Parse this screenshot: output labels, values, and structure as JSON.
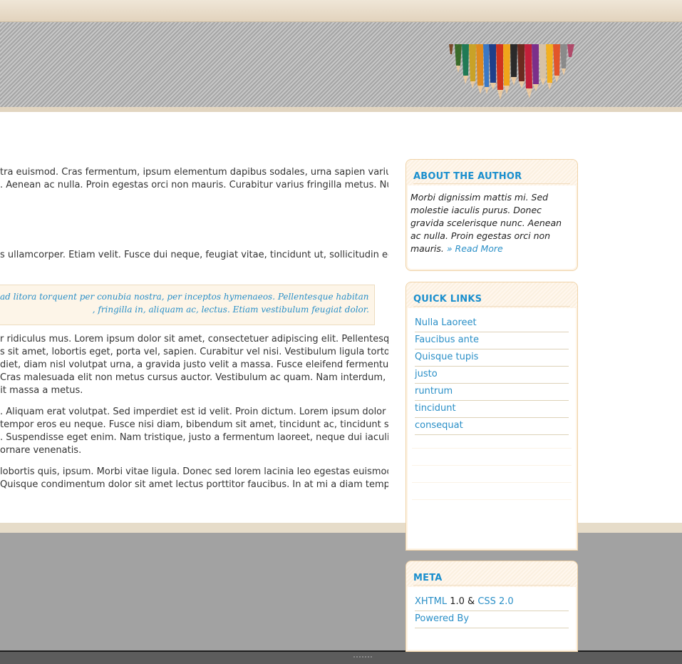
{
  "main": {
    "paragraphs": [
      {
        "lines": [
          "tra euismod. Cras fermentum, ipsum elementum dapibus sodales, urna sapien varius",
          ". Aenean ac nulla. Proin egestas orci non mauris. Curabitur varius fringilla metus. Nulla"
        ]
      },
      {
        "lines": [
          "s ullamcorper. Etiam velit. Fusce dui neque, feugiat vitae, tincidunt ut, sollicitudin eget,"
        ]
      },
      {
        "lines": [
          "r ridiculus mus. Lorem ipsum dolor sit amet, consectetuer adipiscing elit. Pellentesque",
          "s sit amet, lobortis eget, porta vel, sapien. Curabitur vel nisi. Vestibulum ligula tortor,",
          "diet, diam nisl volutpat urna, a gravida justo velit a massa. Fusce eleifend fermentum",
          "Cras malesuada elit non metus cursus auctor. Vestibulum ac quam. Nam interdum, orci",
          "bit massa a metus."
        ]
      },
      {
        "lines": [
          ". Aliquam erat volutpat. Sed imperdiet est id velit. Proin dictum. Lorem ipsum dolor sit",
          "tempor eros eu neque. Fusce nisi diam, bibendum sit amet, tincidunt ac, tincidunt sit",
          ". Suspendisse eget enim. Nam tristique, justo a fermentum laoreet, neque dui iaculis",
          "ornare venenatis."
        ]
      },
      {
        "lines": [
          "lobortis quis, ipsum. Morbi vitae ligula. Donec sed lorem lacinia leo egestas euismod.",
          "Quisque condimentum dolor sit amet lectus porttitor faucibus. In at mi a diam tempus"
        ]
      }
    ],
    "quote_lines": [
      "ad litora torquent per conubia nostra, per inceptos hymenaeos. Pellentesque habitant morbi",
      ", fringilla in, aliquam ac, lectus. Etiam vestibulum feugiat dolor."
    ]
  },
  "sidebar": {
    "about": {
      "title": "ABOUT THE AUTHOR",
      "text": "Morbi dignissim mattis mi. Sed molestie iaculis purus. Donec gravida scelerisque nunc. Aenean ac nulla. Proin egestas orci non mauris.",
      "read_more": "» Read More"
    },
    "quick_links": {
      "title": "QUICK LINKS",
      "items": [
        "Nulla Laoreet",
        "Faucibus ante",
        "Quisque tupis",
        "justo",
        "runtrum",
        "tincidunt",
        "consequat"
      ]
    },
    "meta": {
      "title": "META",
      "xhtml": "XHTML",
      "version_sep": " 1.0 & ",
      "css": "CSS 2.0",
      "powered_by": "Powered By"
    }
  },
  "colors": {
    "link": "#2a8fc7",
    "widget_title": "#1a8fce",
    "footer_bg": "#a2a2a2"
  }
}
